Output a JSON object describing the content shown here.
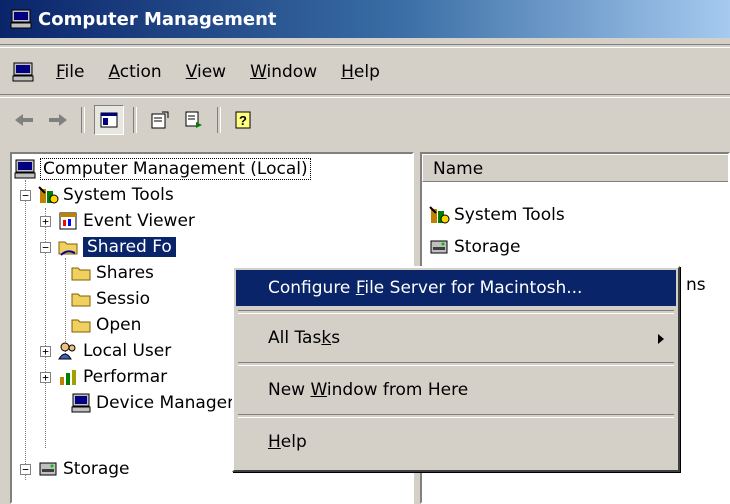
{
  "window": {
    "title": "Computer Management"
  },
  "menubar": {
    "items": [
      {
        "label_pre": "",
        "label_ul": "F",
        "label_post": "ile"
      },
      {
        "label_pre": "",
        "label_ul": "A",
        "label_post": "ction"
      },
      {
        "label_pre": "",
        "label_ul": "V",
        "label_post": "iew"
      },
      {
        "label_pre": "",
        "label_ul": "W",
        "label_post": "indow"
      },
      {
        "label_pre": "",
        "label_ul": "H",
        "label_post": "elp"
      }
    ]
  },
  "tree": {
    "root": "Computer Management (Local)",
    "system_tools": "System Tools",
    "event_viewer": "Event Viewer",
    "shared_folders": "Shared Fo",
    "shares": "Shares",
    "sessions": "Sessio",
    "open_files": "Open",
    "local_users": "Local User",
    "performance": "Performar",
    "device_manager": "Device Manager",
    "storage": "Storage"
  },
  "list": {
    "column_name": "Name",
    "items": [
      "System Tools",
      "Storage"
    ],
    "partial_item": "ns"
  },
  "context_menu": {
    "configure": {
      "pre": "Configure ",
      "ul": "F",
      "post": "ile Server for Macintosh..."
    },
    "all_tasks": {
      "pre": "All Tas",
      "ul": "k",
      "post": "s"
    },
    "new_window": {
      "pre": "New ",
      "ul": "W",
      "post": "indow from Here"
    },
    "help": {
      "pre": "",
      "ul": "H",
      "post": "elp"
    }
  },
  "colors": {
    "title_gradient_start": "#0a246a",
    "title_gradient_end": "#a6caf0",
    "selection": "#0a246a",
    "window_bg": "#d4d0c8"
  }
}
